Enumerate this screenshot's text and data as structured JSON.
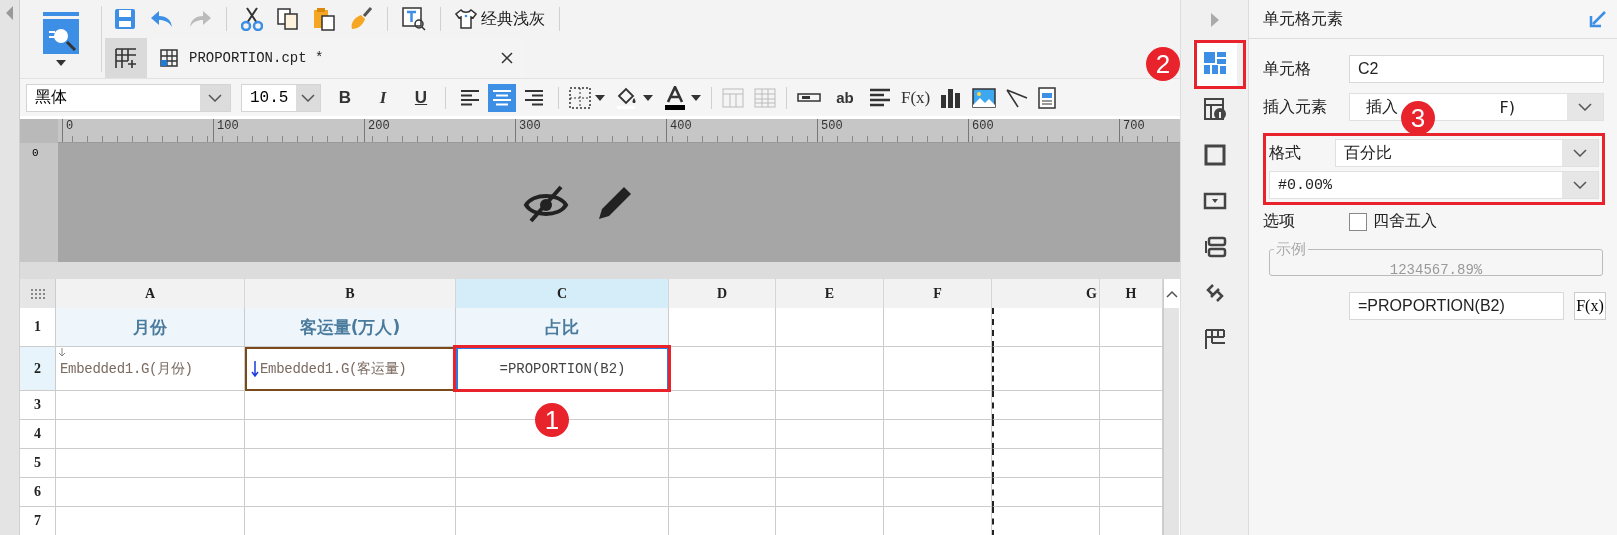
{
  "toolbar": {
    "theme_button": "经典浅灰"
  },
  "tabs": [
    {
      "label": "PROPORTION.cpt *",
      "selected": true
    }
  ],
  "format_bar": {
    "font": "黑体",
    "size": "10.5",
    "bold": "B",
    "italic": "I",
    "underline": "U",
    "align": [
      {
        "selected": false
      },
      {
        "selected": true
      },
      {
        "selected": false
      }
    ],
    "text_tool": "ab",
    "formula_tool": "F(x)"
  },
  "ruler": {
    "labels": [
      "0",
      "100",
      "200",
      "300",
      "400",
      "500",
      "600",
      "700"
    ],
    "side_label": "0"
  },
  "sheet": {
    "columns": [
      {
        "label": "A",
        "selected": false
      },
      {
        "label": "B",
        "selected": false
      },
      {
        "label": "C",
        "selected": true
      },
      {
        "label": "D",
        "selected": false
      },
      {
        "label": "E",
        "selected": false
      },
      {
        "label": "F",
        "selected": false
      },
      {
        "label": "G",
        "selected": false
      },
      {
        "label": "H",
        "selected": false
      }
    ],
    "rows": [
      {
        "number": "1",
        "selected": false,
        "cells": [
          {
            "text": "月份",
            "kind": "heading",
            "selected": false
          },
          {
            "text": "客运量(万人)",
            "kind": "heading",
            "selected": false
          },
          {
            "text": "占比",
            "kind": "heading",
            "selected": false
          }
        ]
      },
      {
        "number": "2",
        "selected": true,
        "cells": [
          {
            "text": "Embedded1.G(月份)",
            "kind": "expand",
            "selected": false
          },
          {
            "text": "Embedded1.G(客运量)",
            "kind": "expand-linked",
            "selected": false
          },
          {
            "text": "=PROPORTION(B2)",
            "kind": "formula",
            "selected": true
          }
        ]
      },
      {
        "number": "3",
        "selected": false
      },
      {
        "number": "4",
        "selected": false
      },
      {
        "number": "5",
        "selected": false
      },
      {
        "number": "6",
        "selected": false
      },
      {
        "number": "7",
        "selected": false
      }
    ]
  },
  "side_tabs": [
    {
      "selected": true
    },
    {
      "selected": false
    },
    {
      "selected": false
    },
    {
      "selected": false
    },
    {
      "selected": false
    },
    {
      "selected": false
    },
    {
      "selected": false
    }
  ],
  "panel": {
    "title": "单元格元素",
    "cell_label": "单元格",
    "cell_value": "C2",
    "insert_label": "插入元素",
    "insert_value_start": "插入",
    "insert_value_end": "F)",
    "format_label": "格式",
    "format_value": "百分比",
    "pattern_value": "#0.00%",
    "option_label": "选项",
    "rounding": {
      "label": "四舍五入",
      "checked": false
    },
    "sample_label": "示例",
    "sample_value": "1234567.89%",
    "formula_value": "=PROPORTION(B2)",
    "formula_button": "F(x)"
  },
  "annotations": [
    "1",
    "2",
    "3"
  ]
}
